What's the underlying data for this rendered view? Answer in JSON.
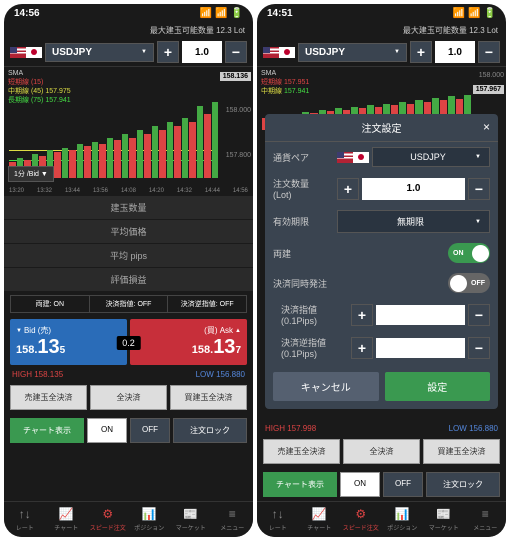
{
  "left": {
    "time": "14:56",
    "lot_info": "最大建玉可能数量 12.3 Lot",
    "pair": "USDJPY",
    "qty": "1.0",
    "chart": {
      "sma": "SMA",
      "short": "短期線 (15)",
      "med": "中期線 (45)",
      "long": "長期線 (75)",
      "short_val": "157.975",
      "med_val": "157.941",
      "tag": "158.136",
      "p1": "158.000",
      "p2": "157.800",
      "tf": "1分 /Bid ▼",
      "times": [
        "13:20",
        "13:32",
        "13:44",
        "13:56",
        "14:08",
        "14:20",
        "14:32",
        "14:44",
        "14:56"
      ]
    },
    "rows": [
      "建玉数量",
      "平均価格",
      "平均 pips",
      "評価損益"
    ],
    "status": {
      "ryo": "両建: ON",
      "sash": "決済指値: OFF",
      "gyak": "決済逆指値: OFF"
    },
    "bid": {
      "lbl": "Bid (売)",
      "whole": "158.",
      "big": "13",
      "sm": "5"
    },
    "ask": {
      "lbl": "(買) Ask",
      "whole": "158.",
      "big": "13",
      "sm": "7"
    },
    "spread": "0.2",
    "high_lbl": "HIGH",
    "high": "158.135",
    "low_lbl": "LOW",
    "low": "156.880",
    "btns1": [
      "売建玉全決済",
      "全決済",
      "買建玉全決済"
    ],
    "btns2": {
      "chart": "チャート表示",
      "on": "ON",
      "off": "OFF",
      "lock": "注文ロック"
    }
  },
  "right": {
    "time": "14:51",
    "lot_info": "最大建玉可能数量 12.3 Lot",
    "pair": "USDJPY",
    "qty": "1.0",
    "chart": {
      "sma": "SMA",
      "short": "短期線",
      "med": "中期線",
      "long": "長期線",
      "short_val": "157.951",
      "med_val": "157.941",
      "tag": "157.967",
      "p1": "158.000"
    },
    "modal": {
      "title": "注文設定",
      "pair_lbl": "通貨ペア",
      "pair": "USDJPY",
      "qty_lbl": "注文数量\n(Lot)",
      "qty": "1.0",
      "exp_lbl": "有効期限",
      "exp": "無期限",
      "ryo_lbl": "両建",
      "ryo_on": "ON",
      "simul_lbl": "決済同時発注",
      "simul_off": "OFF",
      "limit_lbl": "決済指値\n(0.1Pips)",
      "stop_lbl": "決済逆指値\n(0.1Pips)",
      "cancel": "キャンセル",
      "ok": "設定"
    },
    "high_lbl": "HIGH",
    "high": "157.998",
    "low_lbl": "LOW",
    "low": "156.880",
    "btns1": [
      "売建玉全決済",
      "全決済",
      "買建玉全決済"
    ],
    "btns2": {
      "chart": "チャート表示",
      "on": "ON",
      "off": "OFF",
      "lock": "注文ロック"
    }
  },
  "tabs": [
    {
      "icon": "↑↓",
      "lbl": "レート"
    },
    {
      "icon": "📈",
      "lbl": "チャート"
    },
    {
      "icon": "⚙",
      "lbl": "スピード注文"
    },
    {
      "icon": "📊",
      "lbl": "ポジション"
    },
    {
      "icon": "📰",
      "lbl": "マーケット"
    },
    {
      "icon": "≡",
      "lbl": "メニュー"
    }
  ]
}
